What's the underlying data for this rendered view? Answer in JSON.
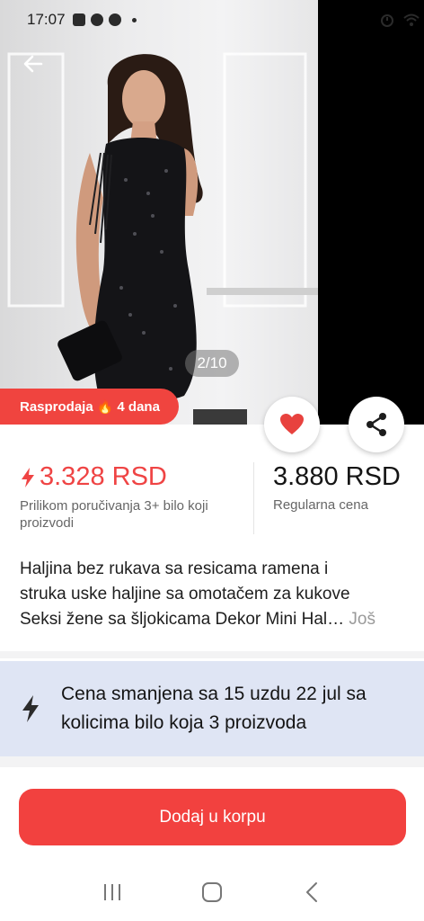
{
  "status_bar": {
    "time": "17:07"
  },
  "product": {
    "image_counter": "2/10",
    "sale_badge_prefix": "Rasprodaja",
    "sale_badge_emoji": "🔥",
    "sale_badge_suffix": "4 dana",
    "sale_price": "3.328 RSD",
    "sale_price_note": "Prilikom poručivanja 3+ bilo koji proizvodi",
    "regular_price": "3.880 RSD",
    "regular_price_label": "Regularna cena",
    "title_lines": [
      "Haljina bez rukava sa resicama ramena i",
      "struka uske haljine sa omotačem za kukove",
      "Seksi žene sa šljokicama Dekor Mini Hal…"
    ],
    "more_label": "Još"
  },
  "promo": {
    "text": "Cena smanjena sa 15 uzdu 22 jul sa kolicima bilo koja 3 proizvoda"
  },
  "cart": {
    "button_label": "Dodaj u korpu"
  },
  "colors": {
    "accent": "#f2413f",
    "promo_bg": "#dfe5f4",
    "price_red": "#ef4444"
  },
  "icons": [
    "back-arrow-icon",
    "heart-icon",
    "share-icon",
    "lightning-icon",
    "recents-icon",
    "home-icon",
    "back-nav-icon"
  ]
}
